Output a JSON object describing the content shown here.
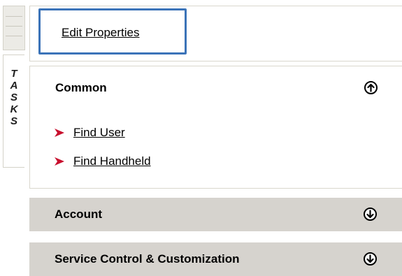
{
  "rail": {
    "tab_label": "T\nA\nS\nK\nS"
  },
  "properties": {
    "edit_link": "Edit Properties"
  },
  "sections": {
    "common": {
      "title": "Common",
      "toggle_icon": "circle-up-arrow-icon",
      "links": [
        "Find User",
        "Find Handheld"
      ],
      "bullet_icon": "red-arrow-bullet-icon",
      "bullet_color": "#c8102e"
    },
    "account": {
      "title": "Account",
      "toggle_icon": "circle-down-arrow-icon"
    },
    "service": {
      "title": "Service Control & Customization",
      "toggle_icon": "circle-down-arrow-icon"
    }
  },
  "colors": {
    "highlight_border": "#3b73b8",
    "collapsed_section_bg": "#d6d3ce"
  }
}
